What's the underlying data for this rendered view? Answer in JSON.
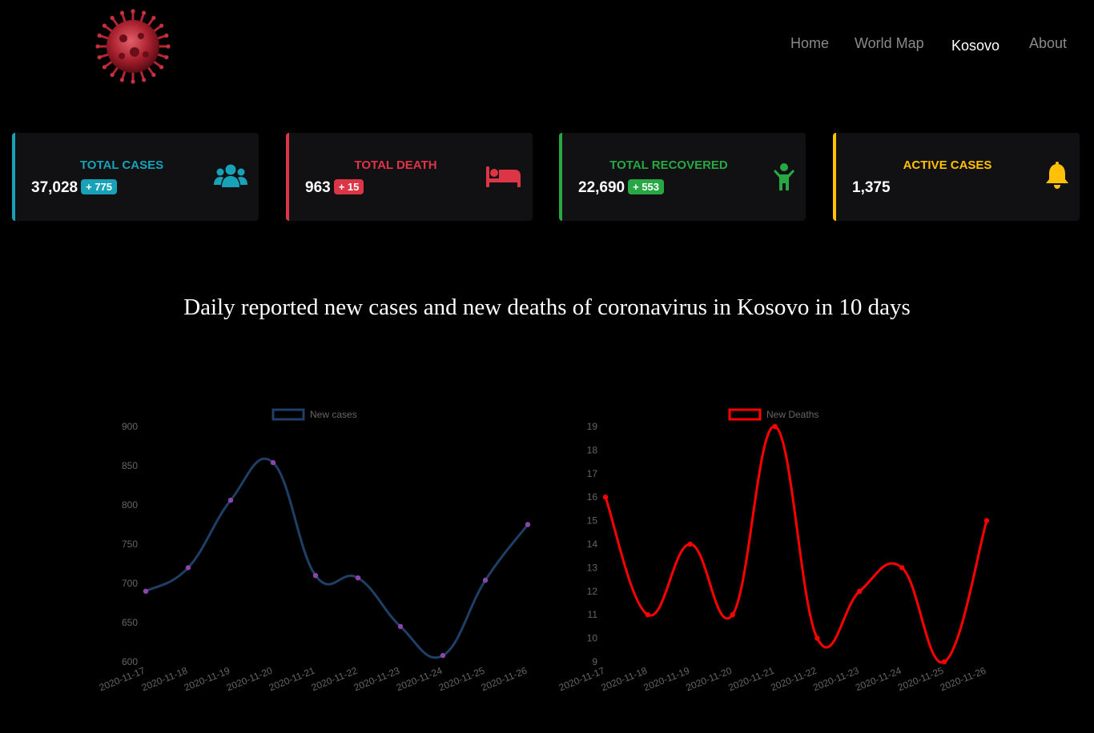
{
  "header": {
    "logo_icon": "coronavirus-logo-icon",
    "nav": [
      {
        "label": "Home",
        "active": false
      },
      {
        "label": "World Map",
        "active": false
      },
      {
        "label": "Kosovo",
        "active": true
      },
      {
        "label": "About",
        "active": false
      }
    ]
  },
  "cards": [
    {
      "title": "TOTAL CASES",
      "value": "37,028",
      "badge": "+ 775",
      "color": "#17a2b8",
      "icon": "users-icon"
    },
    {
      "title": "TOTAL DEATH",
      "value": "963",
      "badge": "+ 15",
      "color": "#dc3545",
      "icon": "bed-icon"
    },
    {
      "title": "TOTAL RECOVERED",
      "value": "22,690",
      "badge": "+ 553",
      "color": "#28a745",
      "icon": "child-icon"
    },
    {
      "title": "ACTIVE CASES",
      "value": "1,375",
      "badge": "",
      "color": "#ffc107",
      "icon": "bell-icon"
    }
  ],
  "charts_heading": "Daily reported new cases and new deaths of coronavirus in Kosovo in 10 days",
  "chart_data": [
    {
      "type": "line",
      "x": [
        "2020-11-17",
        "2020-11-18",
        "2020-11-19",
        "2020-11-20",
        "2020-11-21",
        "2020-11-22",
        "2020-11-23",
        "2020-11-24",
        "2020-11-25",
        "2020-11-26"
      ],
      "series": [
        {
          "name": "New cases",
          "values": [
            690,
            720,
            806,
            854,
            710,
            707,
            645,
            608,
            704,
            775
          ],
          "color": "#1f3f66",
          "point_color": "#8e44ad"
        }
      ],
      "yticks": [
        600,
        650,
        700,
        750,
        800,
        850,
        900
      ],
      "ylim": [
        600,
        900
      ],
      "legend": "top"
    },
    {
      "type": "line",
      "x": [
        "2020-11-17",
        "2020-11-18",
        "2020-11-19",
        "2020-11-20",
        "2020-11-21",
        "2020-11-22",
        "2020-11-23",
        "2020-11-24",
        "2020-11-25",
        "2020-11-26"
      ],
      "series": [
        {
          "name": "New Deaths",
          "values": [
            16,
            11,
            14,
            11,
            19,
            10,
            12,
            13,
            9,
            15
          ],
          "color": "#ff0000",
          "point_color": "#ff0000"
        }
      ],
      "yticks": [
        9,
        10,
        11,
        12,
        13,
        14,
        15,
        16,
        17,
        18,
        19
      ],
      "ylim": [
        9,
        19
      ],
      "legend": "top"
    }
  ]
}
